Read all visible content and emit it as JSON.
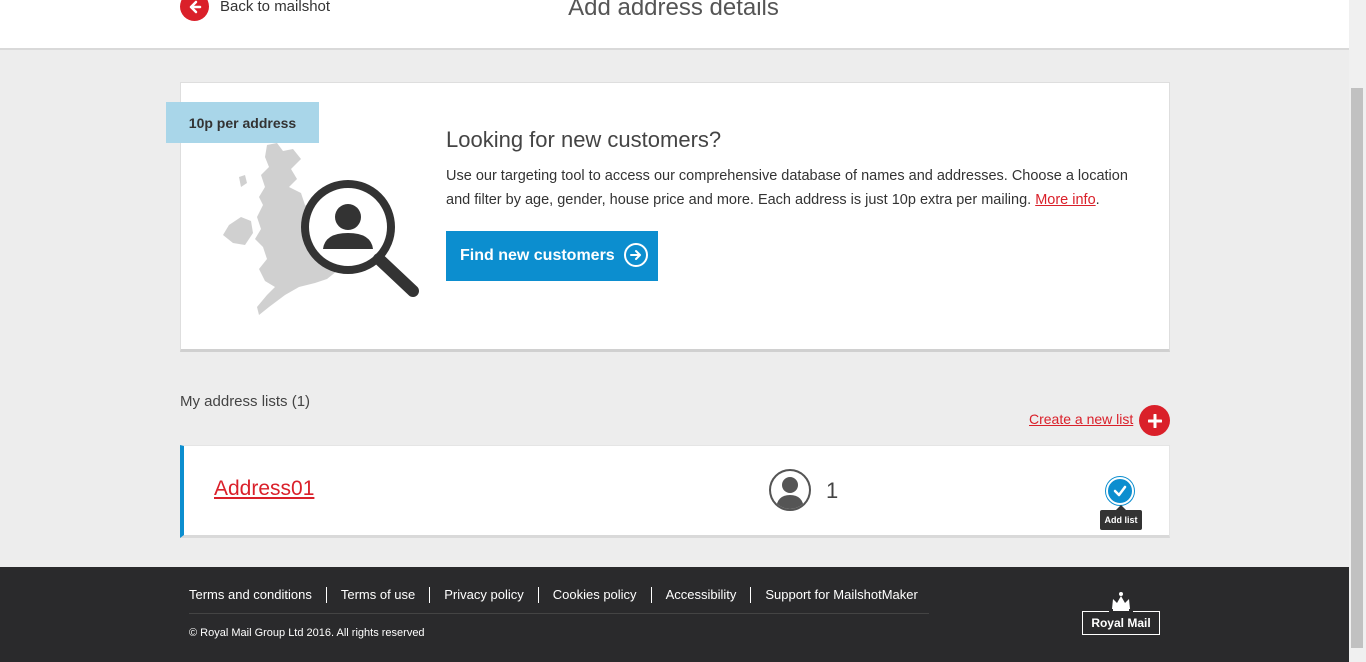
{
  "header": {
    "back_label": "Back to mailshot",
    "title": "Add address details"
  },
  "promo": {
    "price_tag": "10p per address",
    "heading": "Looking for new customers?",
    "text": "Use our targeting tool to access our comprehensive database of names and addresses. Choose a location and filter by age, gender, house price and more. Each address is just 10p extra per mailing.",
    "more_info_label": "More info",
    "button_label": "Find new customers"
  },
  "lists": {
    "heading": "My address lists (1)",
    "create_label": "Create a new list",
    "items": [
      {
        "name": "Address01",
        "count": "1",
        "tooltip": "Add list"
      }
    ]
  },
  "footer": {
    "links": [
      "Terms and conditions",
      "Terms of use",
      "Privacy policy",
      "Cookies policy",
      "Accessibility",
      "Support for MailshotMaker"
    ],
    "copyright": "© Royal Mail Group Ltd 2016. All rights reserved",
    "logo_text": "Royal Mail"
  },
  "colors": {
    "brand_red": "#da202a",
    "accent_blue": "#0c8ecf",
    "price_tag_bg": "#a9d6e9",
    "footer_bg": "#2a2a2c"
  }
}
